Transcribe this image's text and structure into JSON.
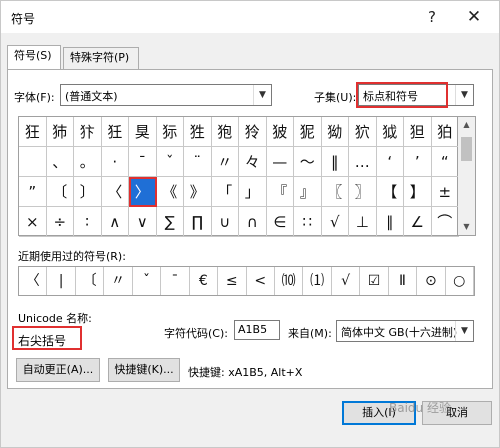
{
  "window": {
    "title": "符号",
    "help_icon": "?",
    "close_icon": "✕"
  },
  "tabs": [
    {
      "label": "符号(S)"
    },
    {
      "label": "特殊字符(P)"
    }
  ],
  "font": {
    "label": "字体(F):",
    "value": "(普通文本)"
  },
  "subset": {
    "label": "子集(U):",
    "value": "标点和符号"
  },
  "symbol_grid": [
    [
      "狂",
      "犻",
      "犿",
      "狅",
      "狊",
      "狋",
      "狌",
      "狍",
      "狑",
      "狓",
      "狔",
      "狕",
      "狖",
      "狘",
      "狚",
      "狛"
    ],
    [
      "",
      "、",
      "。",
      "·",
      "ˉ",
      "ˇ",
      "¨",
      "〃",
      "々",
      "—",
      "～",
      "‖",
      "…",
      "‘",
      "’",
      "“"
    ],
    [
      "”",
      "〔",
      "〕",
      "〈",
      "〉",
      "《",
      "》",
      "「",
      "」",
      "『",
      "』",
      "〖",
      "〗",
      "【",
      "】",
      "±"
    ],
    [
      "×",
      "÷",
      "∶",
      "∧",
      "∨",
      "∑",
      "∏",
      "∪",
      "∩",
      "∈",
      "∷",
      "√",
      "⊥",
      "∥",
      "∠",
      "⌒"
    ]
  ],
  "selected_symbol": "〉",
  "recent": {
    "label": "近期使用过的符号(R):",
    "symbols": [
      "〈",
      "|",
      "〔",
      "〃",
      "ˇ",
      "ˉ",
      "€",
      "≤",
      "<",
      "⑽",
      "⑴",
      "√",
      "☑",
      "Ⅱ",
      "⊙",
      "○"
    ]
  },
  "unicode": {
    "label": "Unicode 名称:",
    "name": "右尖括号"
  },
  "char_code": {
    "label": "字符代码(C):",
    "value": "A1B5"
  },
  "from": {
    "label": "来自(M):",
    "value": "简体中文 GB(十六进制)"
  },
  "buttons": {
    "autocorrect": "自动更正(A)...",
    "shortcut_key": "快捷键(K)...",
    "shortcut_text": "快捷键: xA1B5, Alt+X",
    "insert": "插入(I)",
    "cancel": "取消"
  },
  "watermark": "Baidu 经验"
}
